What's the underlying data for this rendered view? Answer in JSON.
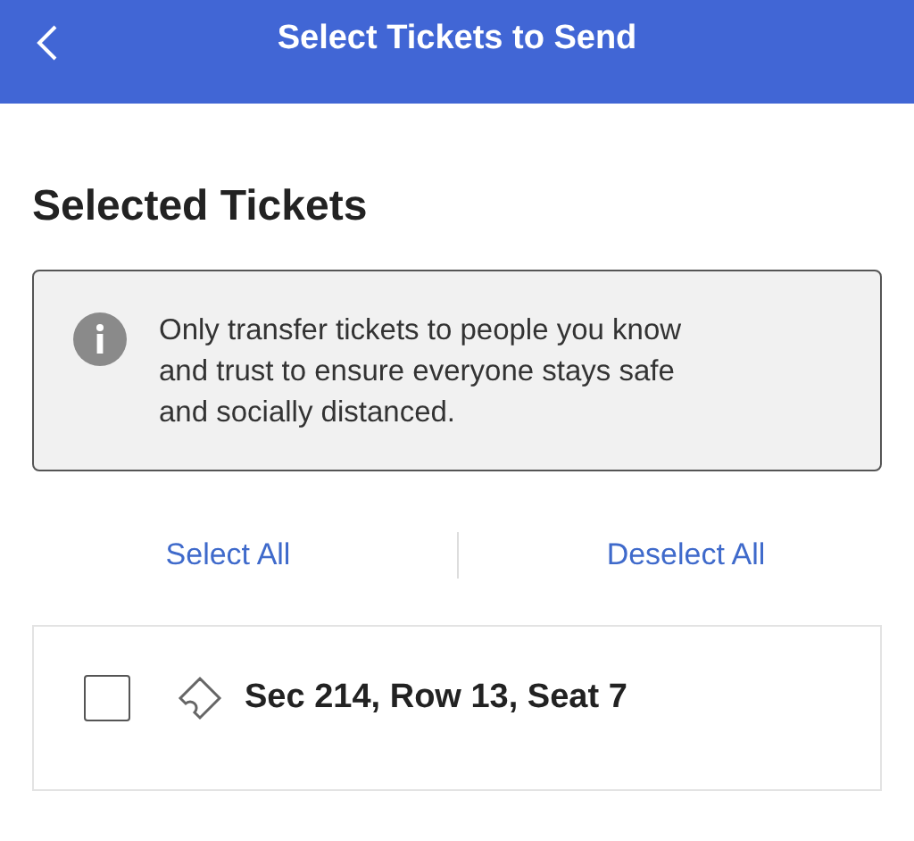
{
  "header": {
    "title": "Select Tickets to Send"
  },
  "section_title": "Selected Tickets",
  "notice": "Only transfer tickets to people you know and trust to ensure everyone stays safe and socially distanced.",
  "actions": [
    "Select All",
    "Deselect All"
  ],
  "tickets": [
    {
      "label": "Sec 214, Row 13, Seat 7",
      "checked": false
    }
  ]
}
